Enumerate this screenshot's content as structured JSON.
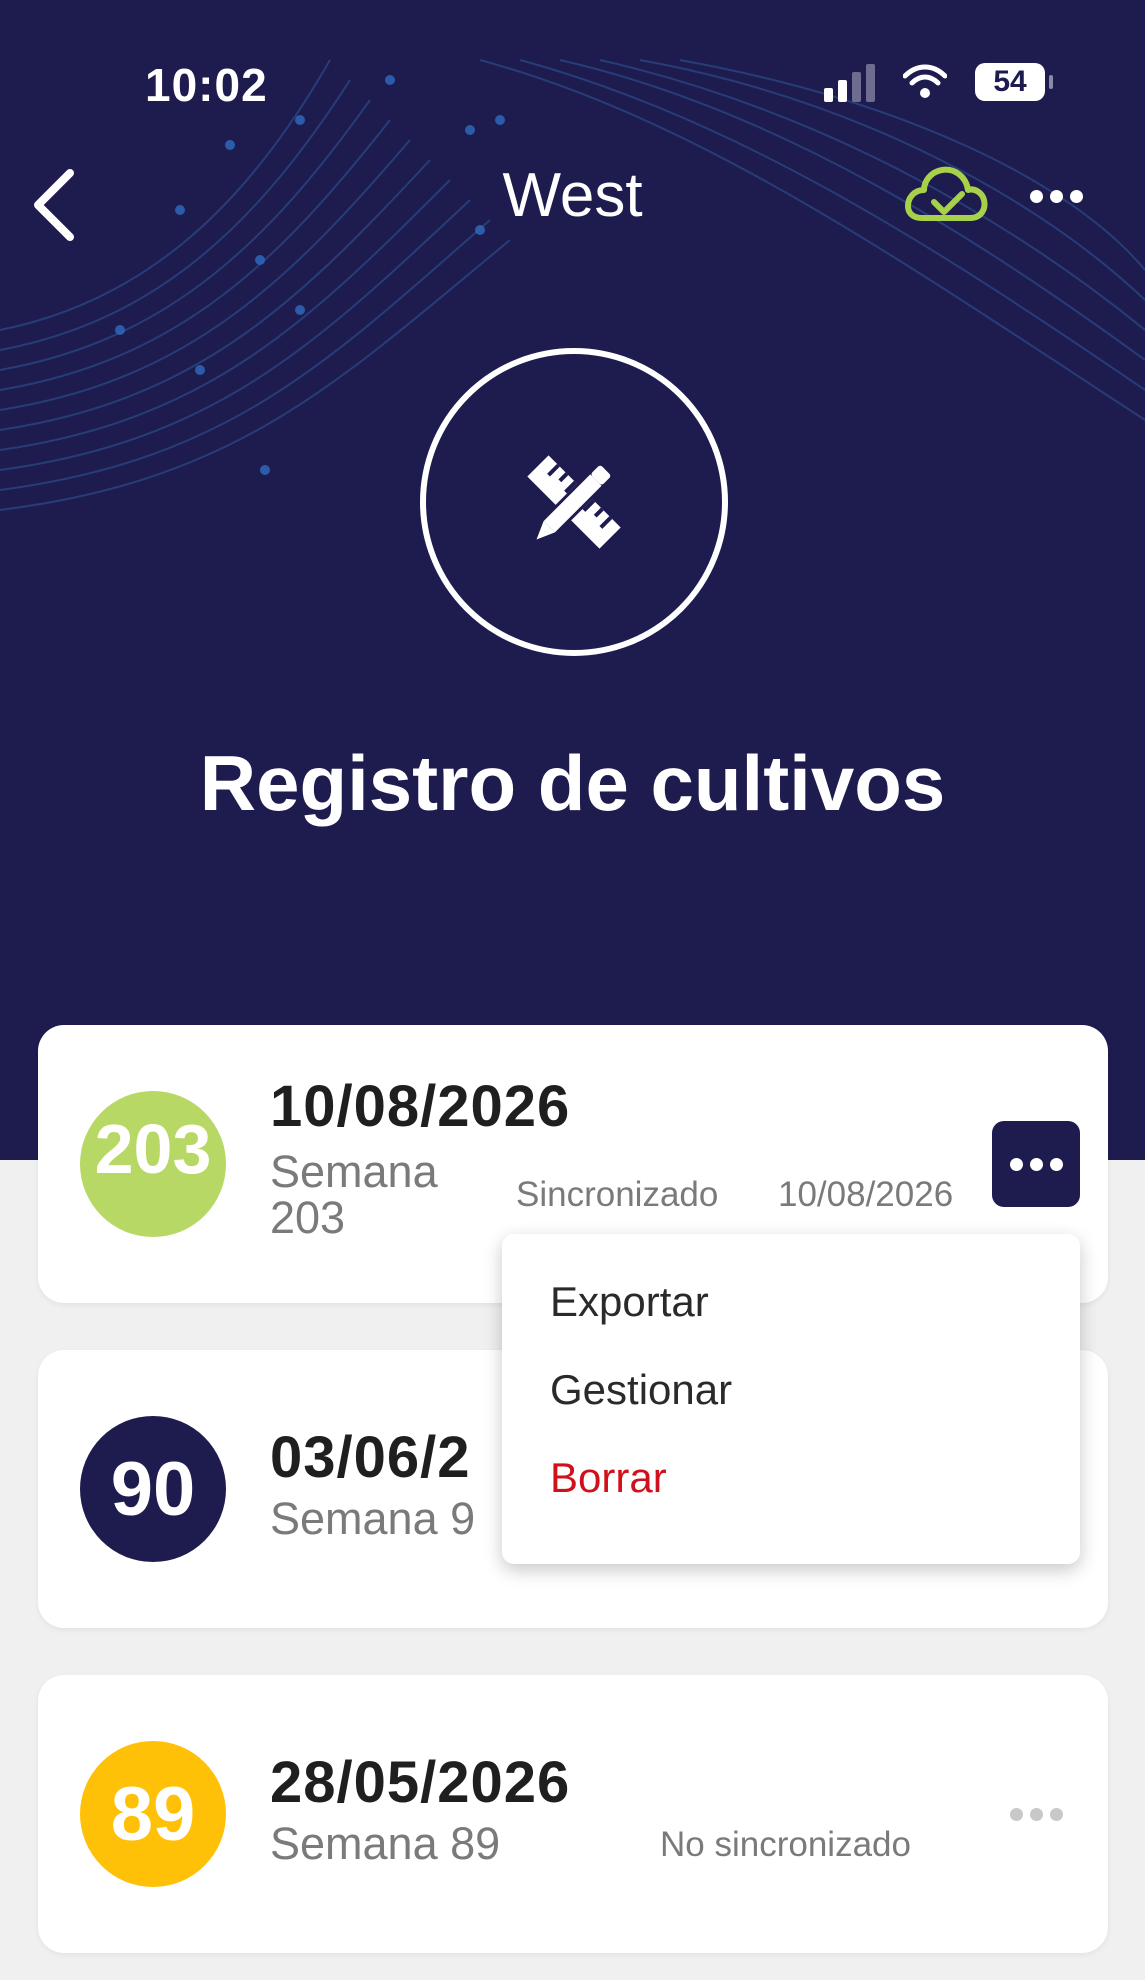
{
  "status_bar": {
    "time": "10:02",
    "battery": "54"
  },
  "header": {
    "title": "West",
    "back_icon": "chevron-left-icon",
    "sync_icon": "cloud-check-icon",
    "more_icon": "more-horizontal-icon"
  },
  "hero": {
    "icon": "ruler-pencil-icon",
    "title": "Registro de cultivos"
  },
  "records": [
    {
      "badge": "203",
      "badge_color": "#b7d865",
      "date": "10/08/2026",
      "week_line1": "Semana",
      "week_line2": "203",
      "sync_label": "Sincronizado",
      "sync_date": "10/08/2026",
      "menu_open": true
    },
    {
      "badge": "90",
      "badge_color": "#1e1b4f",
      "date": "03/06/2",
      "week": "Semana 9"
    },
    {
      "badge": "89",
      "badge_color": "#ffc107",
      "date": "28/05/2026",
      "week": "Semana 89",
      "sync_label": "No sincronizado"
    }
  ],
  "context_menu": {
    "items": [
      {
        "label": "Exportar"
      },
      {
        "label": "Gestionar"
      },
      {
        "label": "Borrar",
        "color": "#d0111b"
      }
    ]
  },
  "colors": {
    "primary": "#1e1b4f",
    "accent_green": "#b7d865",
    "accent_yellow": "#ffc107",
    "danger": "#d0111b"
  }
}
